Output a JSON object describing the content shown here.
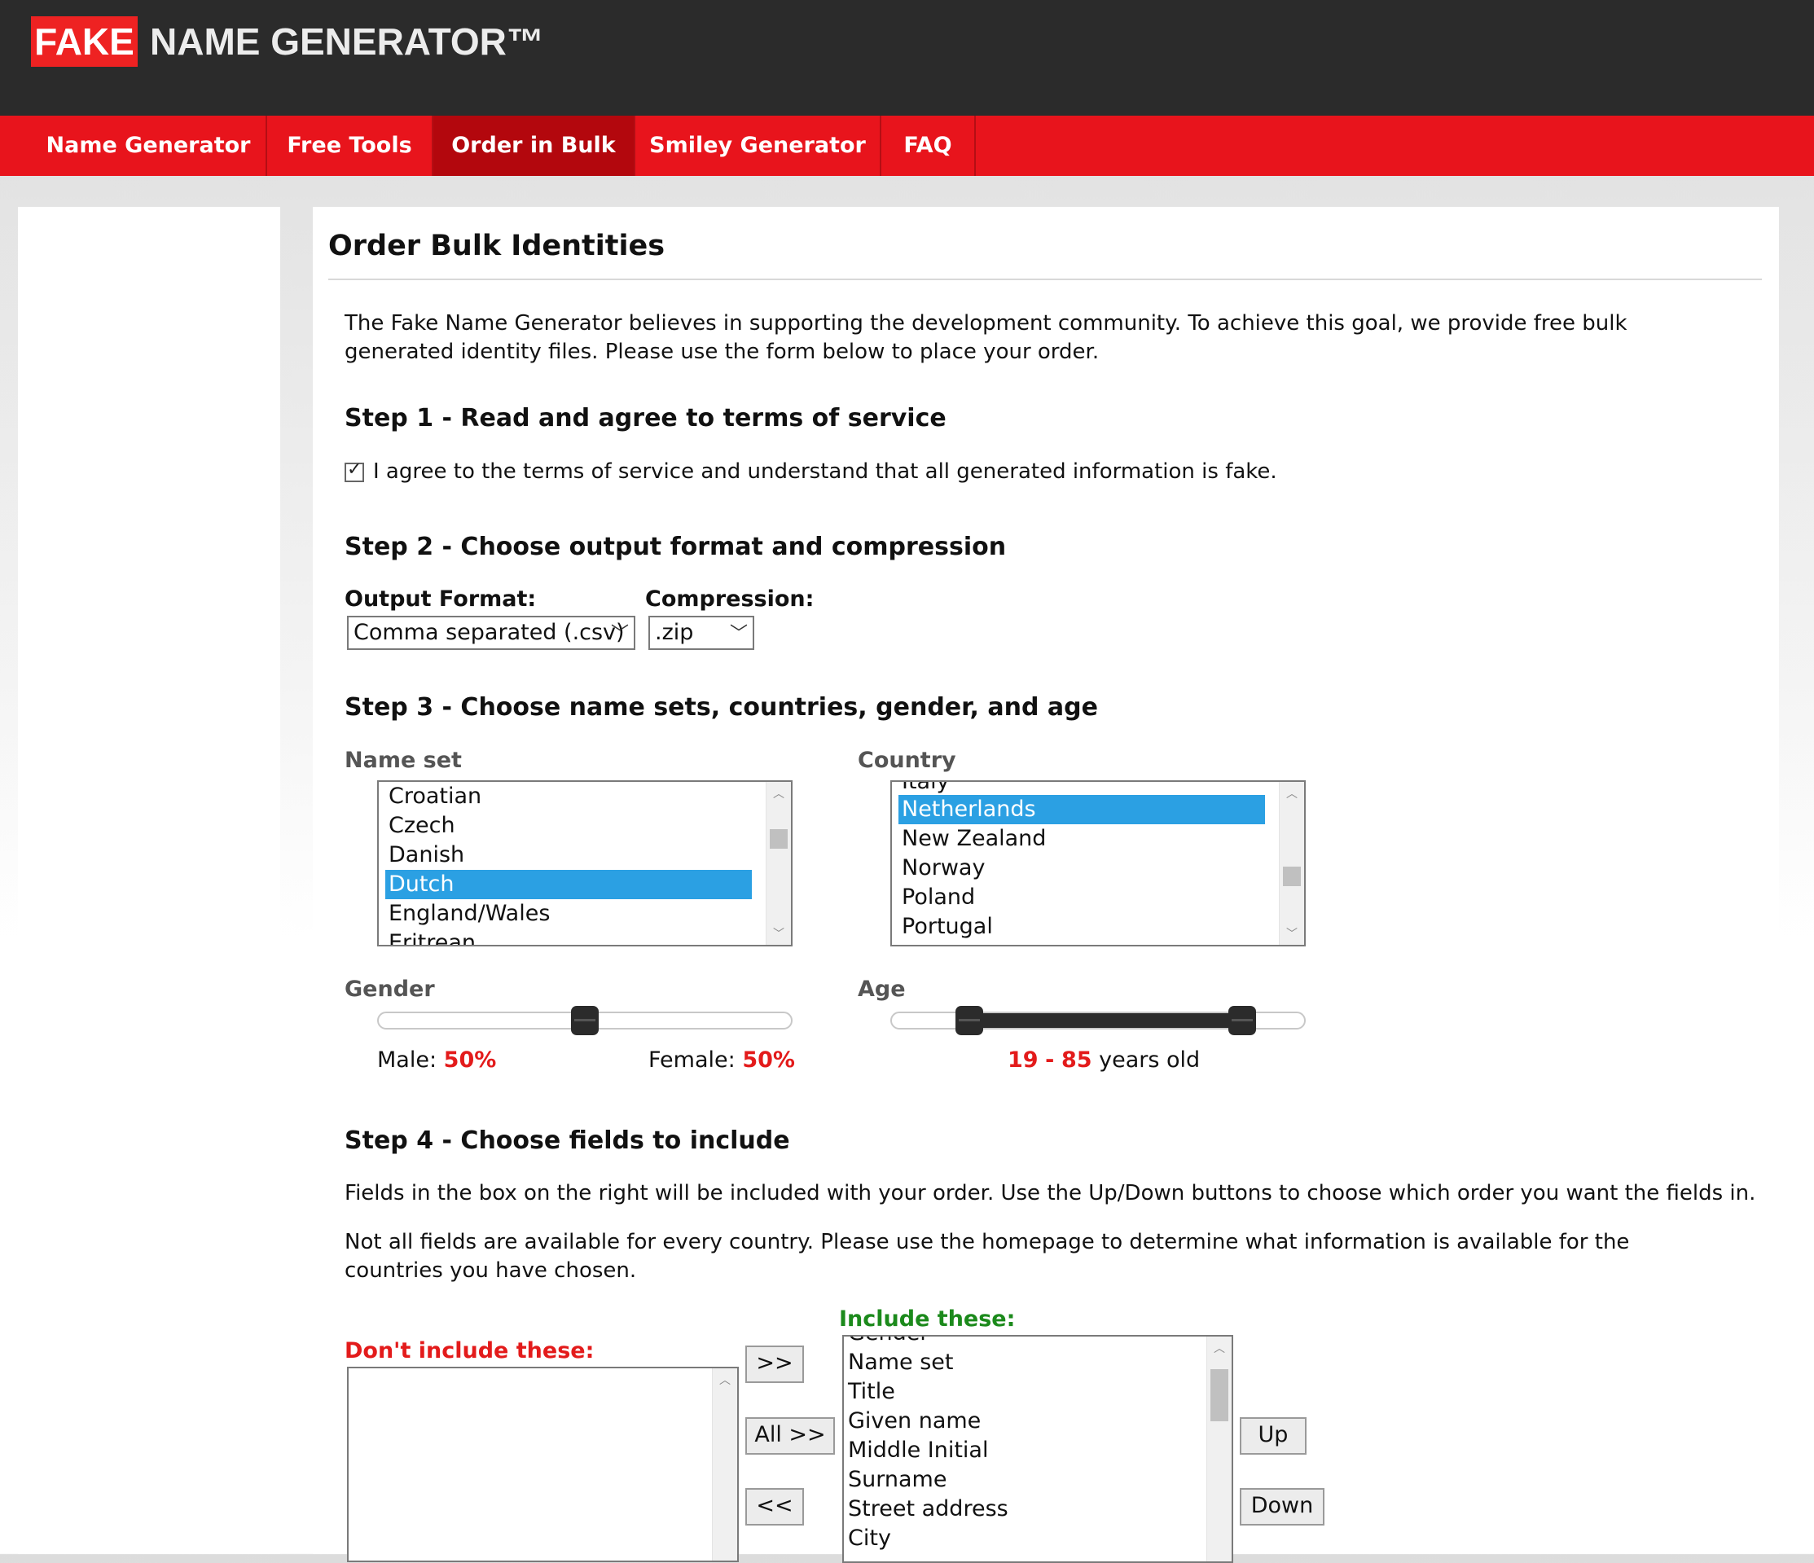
{
  "header": {
    "logo_fake": "FAKE",
    "logo_rest": "NAME GENERATOR™"
  },
  "nav": {
    "items": [
      {
        "label": "Name Generator"
      },
      {
        "label": "Free Tools"
      },
      {
        "label": "Order in Bulk",
        "active": true
      },
      {
        "label": "Smiley Generator"
      },
      {
        "label": "FAQ"
      }
    ]
  },
  "page": {
    "title": "Order Bulk Identities",
    "intro": "The Fake Name Generator believes in supporting the development community. To achieve this goal, we provide free bulk generated identity files. Please use the form below to place your order."
  },
  "step1": {
    "heading": "Step 1 - Read and agree to terms of service",
    "agree_label": "I agree to the terms of service and understand that all generated information is fake.",
    "agreed": true
  },
  "step2": {
    "heading": "Step 2 - Choose output format and compression",
    "format_label": "Output Format:",
    "format_value": "Comma separated (.csv)",
    "compression_label": "Compression:",
    "compression_value": ".zip"
  },
  "step3": {
    "heading": "Step 3 - Choose name sets, countries, gender, and age",
    "nameset_label": "Name set",
    "nameset_options": [
      "Croatian",
      "Czech",
      "Danish",
      "Dutch",
      "England/Wales",
      "Eritrean"
    ],
    "nameset_selected": "Dutch",
    "country_label": "Country",
    "country_options": [
      "Italy",
      "Netherlands",
      "New Zealand",
      "Norway",
      "Poland",
      "Portugal"
    ],
    "country_selected": "Netherlands",
    "gender_label": "Gender",
    "male_label": "Male:",
    "male_pct": "50%",
    "female_label": "Female:",
    "female_pct": "50%",
    "male_fraction": 0.5,
    "age_label": "Age",
    "age_min": "19",
    "age_sep": "-",
    "age_max": "85",
    "age_suffix": "years old"
  },
  "step4": {
    "heading": "Step 4 - Choose fields to include",
    "p1": "Fields in the box on the right will be included with your order. Use the Up/Down buttons to choose which order you want the fields in.",
    "p2": "Not all fields are available for every country. Please use the homepage to determine what information is available for the countries you have chosen.",
    "exclude_label": "Don't include these:",
    "include_label": "Include these:",
    "include_options": [
      "Gender",
      "Name set",
      "Title",
      "Given name",
      "Middle Initial",
      "Surname",
      "Street address",
      "City"
    ],
    "btn_add": ">>",
    "btn_add_all": "All >>",
    "btn_remove": "<<",
    "btn_up": "Up",
    "btn_down": "Down"
  },
  "colors": {
    "brand_red": "#e8141c",
    "nav_active": "#b3070d",
    "header_dark": "#2b2b2b",
    "selection_blue": "#2ba0e3",
    "include_green": "#1c8a1c"
  }
}
